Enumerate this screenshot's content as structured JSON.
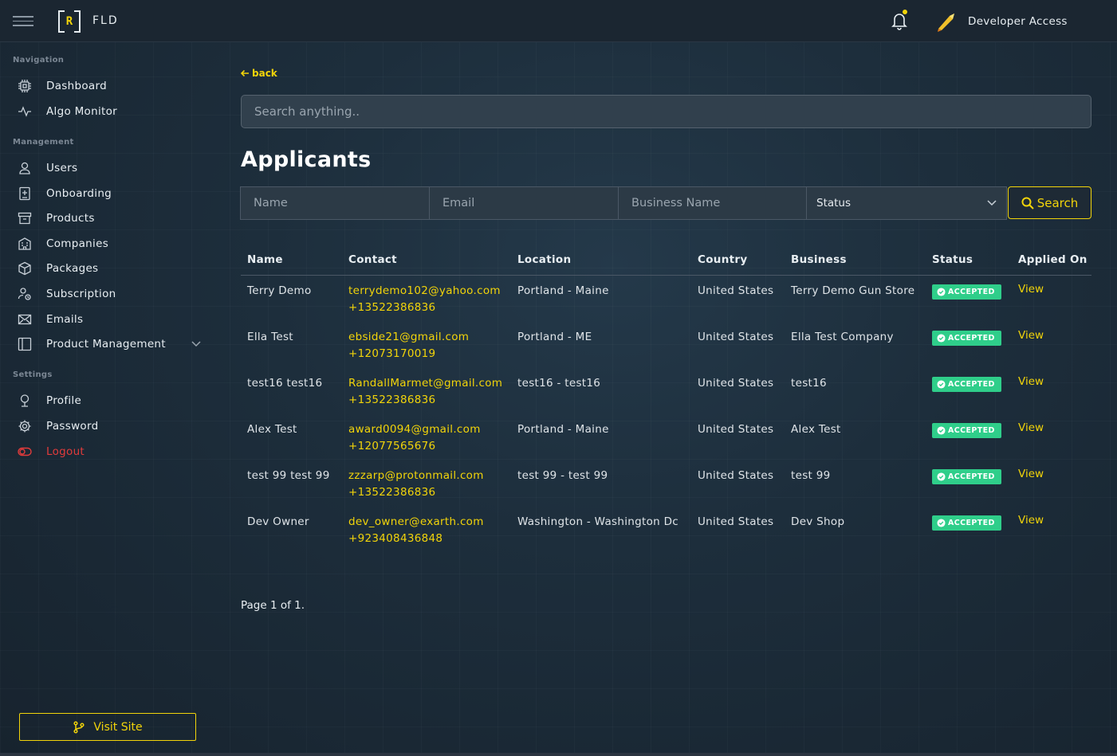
{
  "topbar": {
    "brand": "FLD",
    "logo_letter": "R",
    "user_label": "Developer Access"
  },
  "sidebar": {
    "sections": {
      "navigation": "Navigation",
      "management": "Management",
      "settings": "Settings"
    },
    "navigation": [
      {
        "label": "Dashboard",
        "icon": "dashboard-icon"
      },
      {
        "label": "Algo Monitor",
        "icon": "pulse-icon"
      }
    ],
    "management": [
      {
        "label": "Users",
        "icon": "user-icon"
      },
      {
        "label": "Onboarding",
        "icon": "onboarding-icon"
      },
      {
        "label": "Products",
        "icon": "archive-icon"
      },
      {
        "label": "Companies",
        "icon": "building-icon"
      },
      {
        "label": "Packages",
        "icon": "cube-icon"
      },
      {
        "label": "Subscription",
        "icon": "subscription-icon"
      },
      {
        "label": "Emails",
        "icon": "mail-icon"
      },
      {
        "label": "Product Management",
        "icon": "panel-icon"
      }
    ],
    "settings": [
      {
        "label": "Profile",
        "icon": "profile-icon"
      },
      {
        "label": "Password",
        "icon": "gear-icon"
      },
      {
        "label": "Logout",
        "icon": "logout-icon"
      }
    ],
    "visit_site": "Visit Site"
  },
  "main": {
    "back_label": "back",
    "search_placeholder": "Search anything..",
    "title": "Applicants",
    "filters": {
      "name_placeholder": "Name",
      "email_placeholder": "Email",
      "business_placeholder": "Business Name",
      "status_value": "Status",
      "search_button": "Search"
    },
    "table": {
      "headers": [
        "Name",
        "Contact",
        "Location",
        "Country",
        "Business",
        "Status",
        "Applied On"
      ],
      "rows": [
        {
          "name": "Terry Demo",
          "email": "terrydemo102@yahoo.com",
          "phone": "+13522386836",
          "location": "Portland - Maine",
          "country": "United States",
          "business": "Terry Demo Gun Store",
          "status": "ACCEPTED",
          "action": "View"
        },
        {
          "name": "Ella Test",
          "email": "ebside21@gmail.com",
          "phone": "+12073170019",
          "location": "Portland - ME",
          "country": "United States",
          "business": "Ella Test Company",
          "status": "ACCEPTED",
          "action": "View"
        },
        {
          "name": "test16 test16",
          "email": "RandallMarmet@gmail.com",
          "phone": "+13522386836",
          "location": "test16 - test16",
          "country": "United States",
          "business": "test16",
          "status": "ACCEPTED",
          "action": "View"
        },
        {
          "name": "Alex Test",
          "email": "award0094@gmail.com",
          "phone": "+12077565676",
          "location": "Portland - Maine",
          "country": "United States",
          "business": "Alex Test",
          "status": "ACCEPTED",
          "action": "View"
        },
        {
          "name": "test 99 test 99",
          "email": "zzzarp@protonmail.com",
          "phone": "+13522386836",
          "location": "test 99 - test 99",
          "country": "United States",
          "business": "test 99",
          "status": "ACCEPTED",
          "action": "View"
        },
        {
          "name": "Dev Owner",
          "email": "dev_owner@exarth.com",
          "phone": "+923408436848",
          "location": "Washington - Washington Dc",
          "country": "United States",
          "business": "Dev Shop",
          "status": "ACCEPTED",
          "action": "View"
        }
      ]
    },
    "pagination": "Page 1 of 1."
  },
  "colors": {
    "accent": "#f2d40a",
    "accepted": "#2fce8a",
    "logout": "#e23b3b",
    "background": "#1a2733"
  }
}
